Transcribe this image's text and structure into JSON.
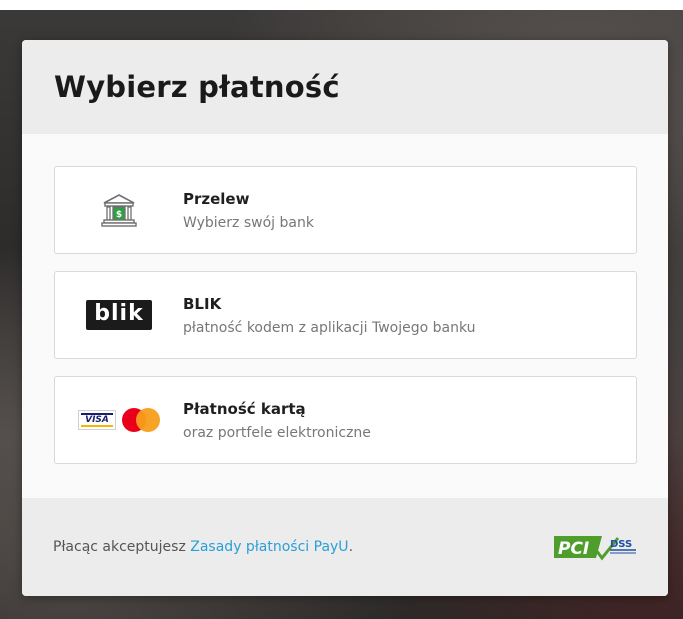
{
  "modal": {
    "title": "Wybierz płatność"
  },
  "options": [
    {
      "title": "Przelew",
      "subtitle": "Wybierz swój bank",
      "icon": "bank-icon"
    },
    {
      "title": "BLIK",
      "subtitle": "płatność kodem z aplikacji Twojego banku",
      "icon": "blik-logo",
      "logo_text": "blik"
    },
    {
      "title": "Płatność kartą",
      "subtitle": "oraz portfele elektroniczne",
      "icon": "card-logos",
      "visa_text": "VISA"
    }
  ],
  "footer": {
    "text_prefix": "Płacąc akceptujesz ",
    "link_text": "Zasady płatności PayU",
    "text_suffix": ".",
    "pci_text": "PCI",
    "dss_text": "DSS"
  },
  "colors": {
    "link": "#2a9fd6",
    "pci_green": "#4f9e2b",
    "mastercard_red": "#eb001b",
    "mastercard_orange": "#f79e1b",
    "visa_blue": "#1a1f71"
  }
}
